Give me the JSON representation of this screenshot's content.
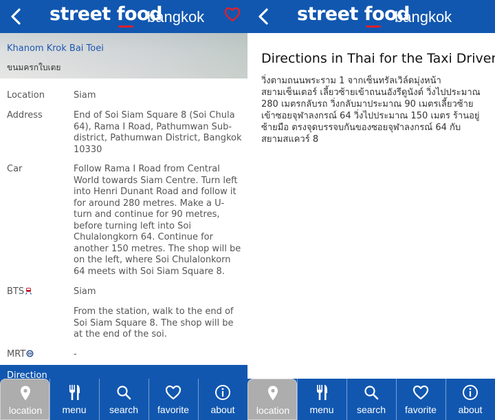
{
  "app": {
    "logo_main": "street food",
    "logo_city": "bangkok"
  },
  "colors": {
    "brand_blue": "#1157b0",
    "accent_red": "#e0202a",
    "active_tab": "#adadad"
  },
  "shop": {
    "name": "Khanom Krok Bai Toei",
    "thai_name": "ขนมครกใบเตย"
  },
  "info": {
    "location_label": "Location",
    "location_value": "Siam",
    "address_label": "Address",
    "address_value": "End of Soi Siam Square 8 (Soi Chula 64), Rama I Road, Pathumwan Sub-district, Pathumwan District, Bangkok 10330",
    "car_label": "Car",
    "car_value": "Follow Rama I Road from Central World towards Siam Centre. Turn left into Henri Dunant Road and follow it for around 280 metres.  Make a U-turn and continue for 90 metres, before turning left into Soi Chulalongkorn 64. Continue for another 150 metres. The shop will be on the left, where Soi Chulalonkorn 64 meets with Soi Siam Square 8.",
    "bts_label": "BTS",
    "bts_value": "Siam",
    "bts_directions": "From the station, walk to the end of Soi Siam Square 8. The shop will be at the end of the soi.",
    "mrt_label": "MRT",
    "mrt_value": "-",
    "direction_label": "Direction"
  },
  "directions": {
    "title": "Directions in Thai for the Taxi Driver",
    "body": "วิ่งตามถนนพระราม 1 จากเซ็นทรัลเวิล์ดมุ่งหน้าสยามเซ็นเตอร์  เลี้ยวซ้ายเข้าถนนอังรีดูนังต์ วิ่งไปประมาณ 280 เมตรกลับรถ วิ่งกลับมาประมาณ 90 เมตรเลี้ยวซ้ายเข้าซอยจุฬาลงกรณ์ 64  วิ่งไปประมาณ 150 เมตร ร้านอยู่ซ้ายมือ ตรงจุดบรรจบกันของซอยจุฬาลงกรณ์ 64 กับสยามสแควร์ 8"
  },
  "nav": {
    "location": "location",
    "menu": "menu",
    "search": "search",
    "favorite": "favorite",
    "about": "about",
    "active": "location"
  },
  "icons": {
    "back": "chevron-left-icon",
    "favorite_header": "heart-outline-icon",
    "location": "map-pin-icon",
    "menu": "fork-knife-icon",
    "search": "magnifier-icon",
    "favorite": "heart-outline-icon",
    "about": "info-circle-icon",
    "bts": "bts-train-icon",
    "mrt": "mrt-logo-icon"
  }
}
